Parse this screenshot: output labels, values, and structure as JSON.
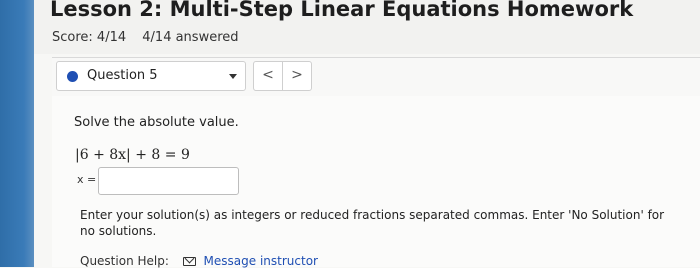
{
  "lesson": {
    "title": "Lesson 2: Multi-Step Linear Equations Homework",
    "score": "Score: 4/14",
    "answered": "4/14 answered"
  },
  "nav": {
    "question_label": "Question 5",
    "prev_symbol": "<",
    "next_symbol": ">"
  },
  "question": {
    "instruction": "Solve the absolute value.",
    "equation": "|6 + 8x| + 8 = 9",
    "answer_label": "x =",
    "answer_value": "",
    "hint": "Enter your solution(s) as integers or reduced fractions separated commas. Enter 'No Solution' for no solutions."
  },
  "help": {
    "label": "Question Help:",
    "message_link": "Message instructor"
  },
  "colors": {
    "accent": "#1f4fb3",
    "strip": "#3a7bb8"
  }
}
